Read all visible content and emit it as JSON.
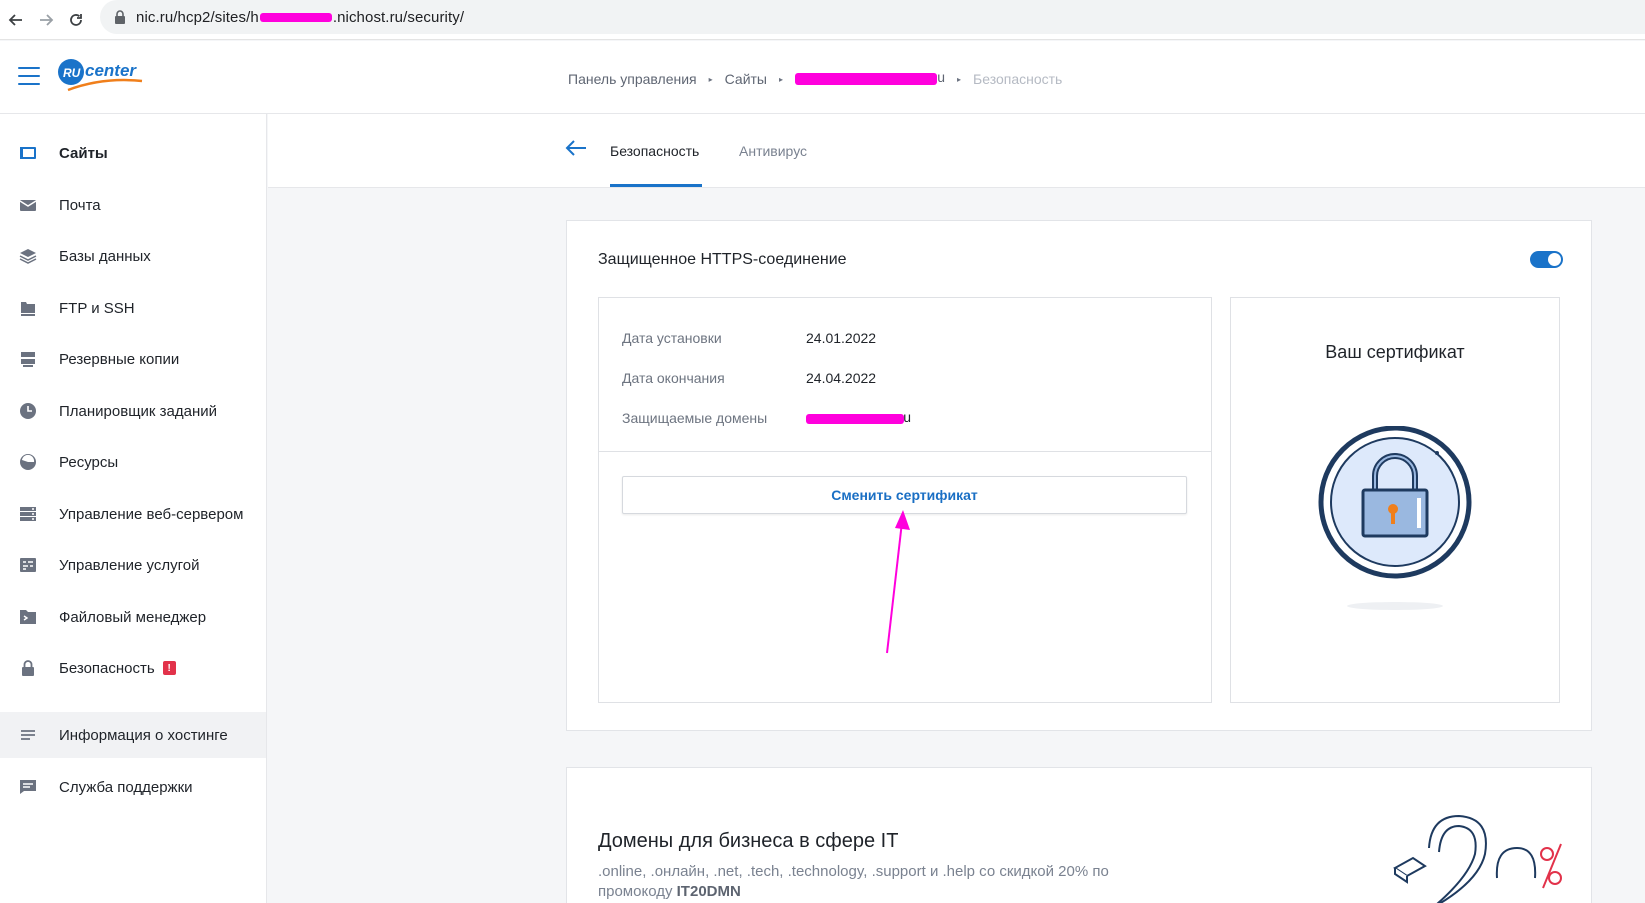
{
  "browser": {
    "url_prefix": "nic.ru/hcp2/sites/",
    "url_redacted_start": "h",
    "url_suffix": ".nichost.ru/security/"
  },
  "header": {
    "logo_text_ru": "RU",
    "logo_text_center": "center",
    "breadcrumb": {
      "item1": "Панель управления",
      "item2": "Сайты",
      "current": "Безопасность"
    }
  },
  "sidebar": {
    "items": [
      {
        "label": "Сайты",
        "icon": "sites-icon"
      },
      {
        "label": "Почта",
        "icon": "mail-icon"
      },
      {
        "label": "Базы данных",
        "icon": "database-icon"
      },
      {
        "label": "FTP и SSH",
        "icon": "ftp-icon"
      },
      {
        "label": "Резервные копии",
        "icon": "backup-icon"
      },
      {
        "label": "Планировщик заданий",
        "icon": "clock-icon"
      },
      {
        "label": "Ресурсы",
        "icon": "resources-icon"
      },
      {
        "label": "Управление веб-сервером",
        "icon": "server-icon"
      },
      {
        "label": "Управление услугой",
        "icon": "service-icon"
      },
      {
        "label": "Файловый менеджер",
        "icon": "terminal-icon"
      },
      {
        "label": "Безопасность",
        "icon": "lock-icon",
        "badge": "!"
      },
      {
        "label": "Информация о хостинге",
        "icon": "list-icon"
      },
      {
        "label": "Служба поддержки",
        "icon": "chat-icon"
      }
    ]
  },
  "tabs": {
    "security": "Безопасность",
    "antivirus": "Антивирус"
  },
  "https": {
    "title": "Защищенное HTTPS-соединение",
    "enabled": true,
    "install_label": "Дата установки",
    "install_value": "24.01.2022",
    "expiry_label": "Дата окончания",
    "expiry_value": "24.04.2022",
    "domains_label": "Защищаемые домены",
    "change_button": "Сменить сертификат",
    "cert_title": "Ваш сертификат"
  },
  "promo": {
    "title": "Домены для бизнеса в сфере IT",
    "text": ".online, .онлайн, .net, .tech, .technology, .support и .help со скидкой 20% по промокоду ",
    "code": "IT20DMN"
  },
  "colors": {
    "accent": "#1a73c9",
    "annotation": "#ff00dd",
    "badge": "#e2324a"
  }
}
